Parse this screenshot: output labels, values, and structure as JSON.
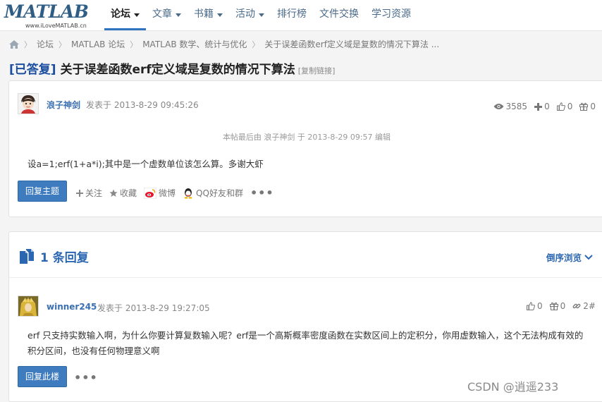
{
  "logo": {
    "main": "MATLAB",
    "sub": "www.iLoveMATLAB.cn"
  },
  "nav": [
    {
      "label": "论坛",
      "active": true,
      "dropdown": true
    },
    {
      "label": "文章",
      "dropdown": true
    },
    {
      "label": "书籍",
      "dropdown": true
    },
    {
      "label": "活动",
      "dropdown": true
    },
    {
      "label": "排行榜"
    },
    {
      "label": "文件交换"
    },
    {
      "label": "学习资源"
    }
  ],
  "breadcrumb": [
    "论坛",
    "MATLAB 论坛",
    "MATLAB 数学、统计与优化",
    "关于误差函数erf定义域是复数的情况下算法 ..."
  ],
  "title": {
    "tag": "[已答复]",
    "text": " 关于误差函数erf定义域是复数的情况下算法",
    "copy_link": "[复制链接]"
  },
  "post": {
    "author": "浪子神剑",
    "posted": "发表于 2013-8-29 09:45:26",
    "views": "3585",
    "plus": "0",
    "likes": "0",
    "gifts": "0",
    "edited": "本帖最后由 浪子神剑 于 2013-8-29 09:57 编辑",
    "content": "设a=1;erf(1+a*i);其中是一个虚数单位该怎么算。多谢大虾",
    "reply_button": "回复主题",
    "actions": {
      "follow": "关注",
      "favorite": "收藏",
      "weibo": "微博",
      "qq": "QQ好友和群"
    }
  },
  "replies": {
    "heading": "1 条回复",
    "sort": "倒序浏览",
    "items": [
      {
        "author": "winner245",
        "posted": "发表于 2013-8-29 19:27:05",
        "likes": "0",
        "gifts": "0",
        "floor": "2#",
        "content": "erf 只支持实数输入啊，为什么你要计算复数输入呢？erf是一个高斯概率密度函数在实数区间上的定积分，你用虚数输入，这个无法构成有效的积分区间，也没有任何物理意义啊",
        "reply_button": "回复此楼"
      }
    ]
  },
  "watermark": "CSDN @逍遥233",
  "colors": {
    "accent": "#3e7bbf",
    "link": "#2b66b0",
    "nav_active_border": "#2f74c0"
  }
}
